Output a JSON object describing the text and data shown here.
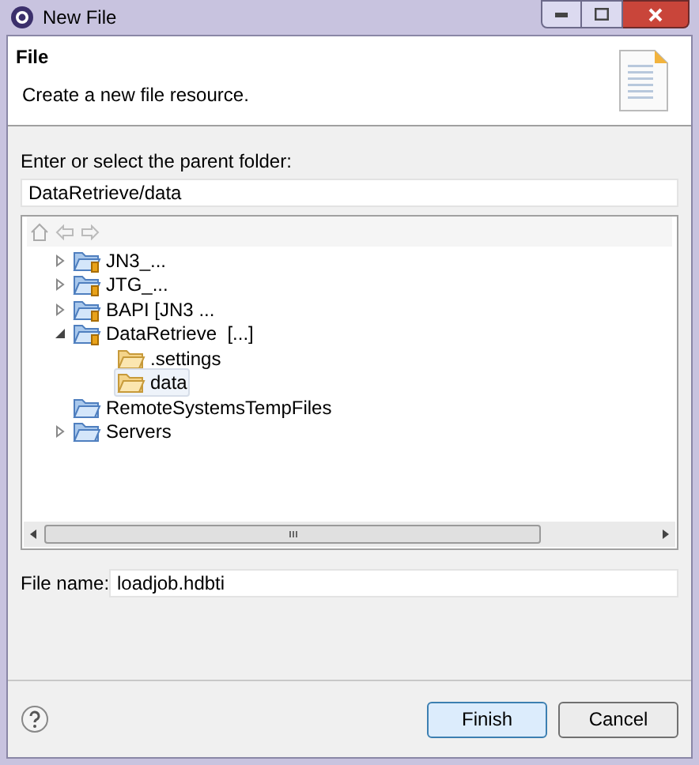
{
  "window": {
    "title": "New File"
  },
  "header": {
    "title": "File",
    "description": "Create a new file resource."
  },
  "parent_folder": {
    "label": "Enter or select the parent folder:",
    "value": "DataRetrieve/data"
  },
  "tree": [
    {
      "label": "JN3_...",
      "kind": "project",
      "expanded": false,
      "selected": false
    },
    {
      "label": "JTG_...",
      "kind": "project",
      "expanded": false,
      "selected": false
    },
    {
      "label": "BAPI [JN3 ...",
      "kind": "project",
      "expanded": false,
      "selected": false
    },
    {
      "label": "DataRetrieve  [...]",
      "kind": "project",
      "expanded": true,
      "selected": false,
      "children": [
        {
          "label": ".settings",
          "kind": "folder",
          "selected": false
        },
        {
          "label": "data",
          "kind": "folder",
          "selected": true
        }
      ]
    },
    {
      "label": "RemoteSystemsTempFiles",
      "kind": "plain",
      "selected": false
    },
    {
      "label": "Servers",
      "kind": "plain",
      "expanded": false,
      "selected": false
    }
  ],
  "file_name": {
    "label": "File name:",
    "value": "loadjob.hdbti"
  },
  "buttons": [
    {
      "label": "Finish",
      "kind": "default"
    },
    {
      "label": "Cancel",
      "kind": "normal"
    }
  ]
}
